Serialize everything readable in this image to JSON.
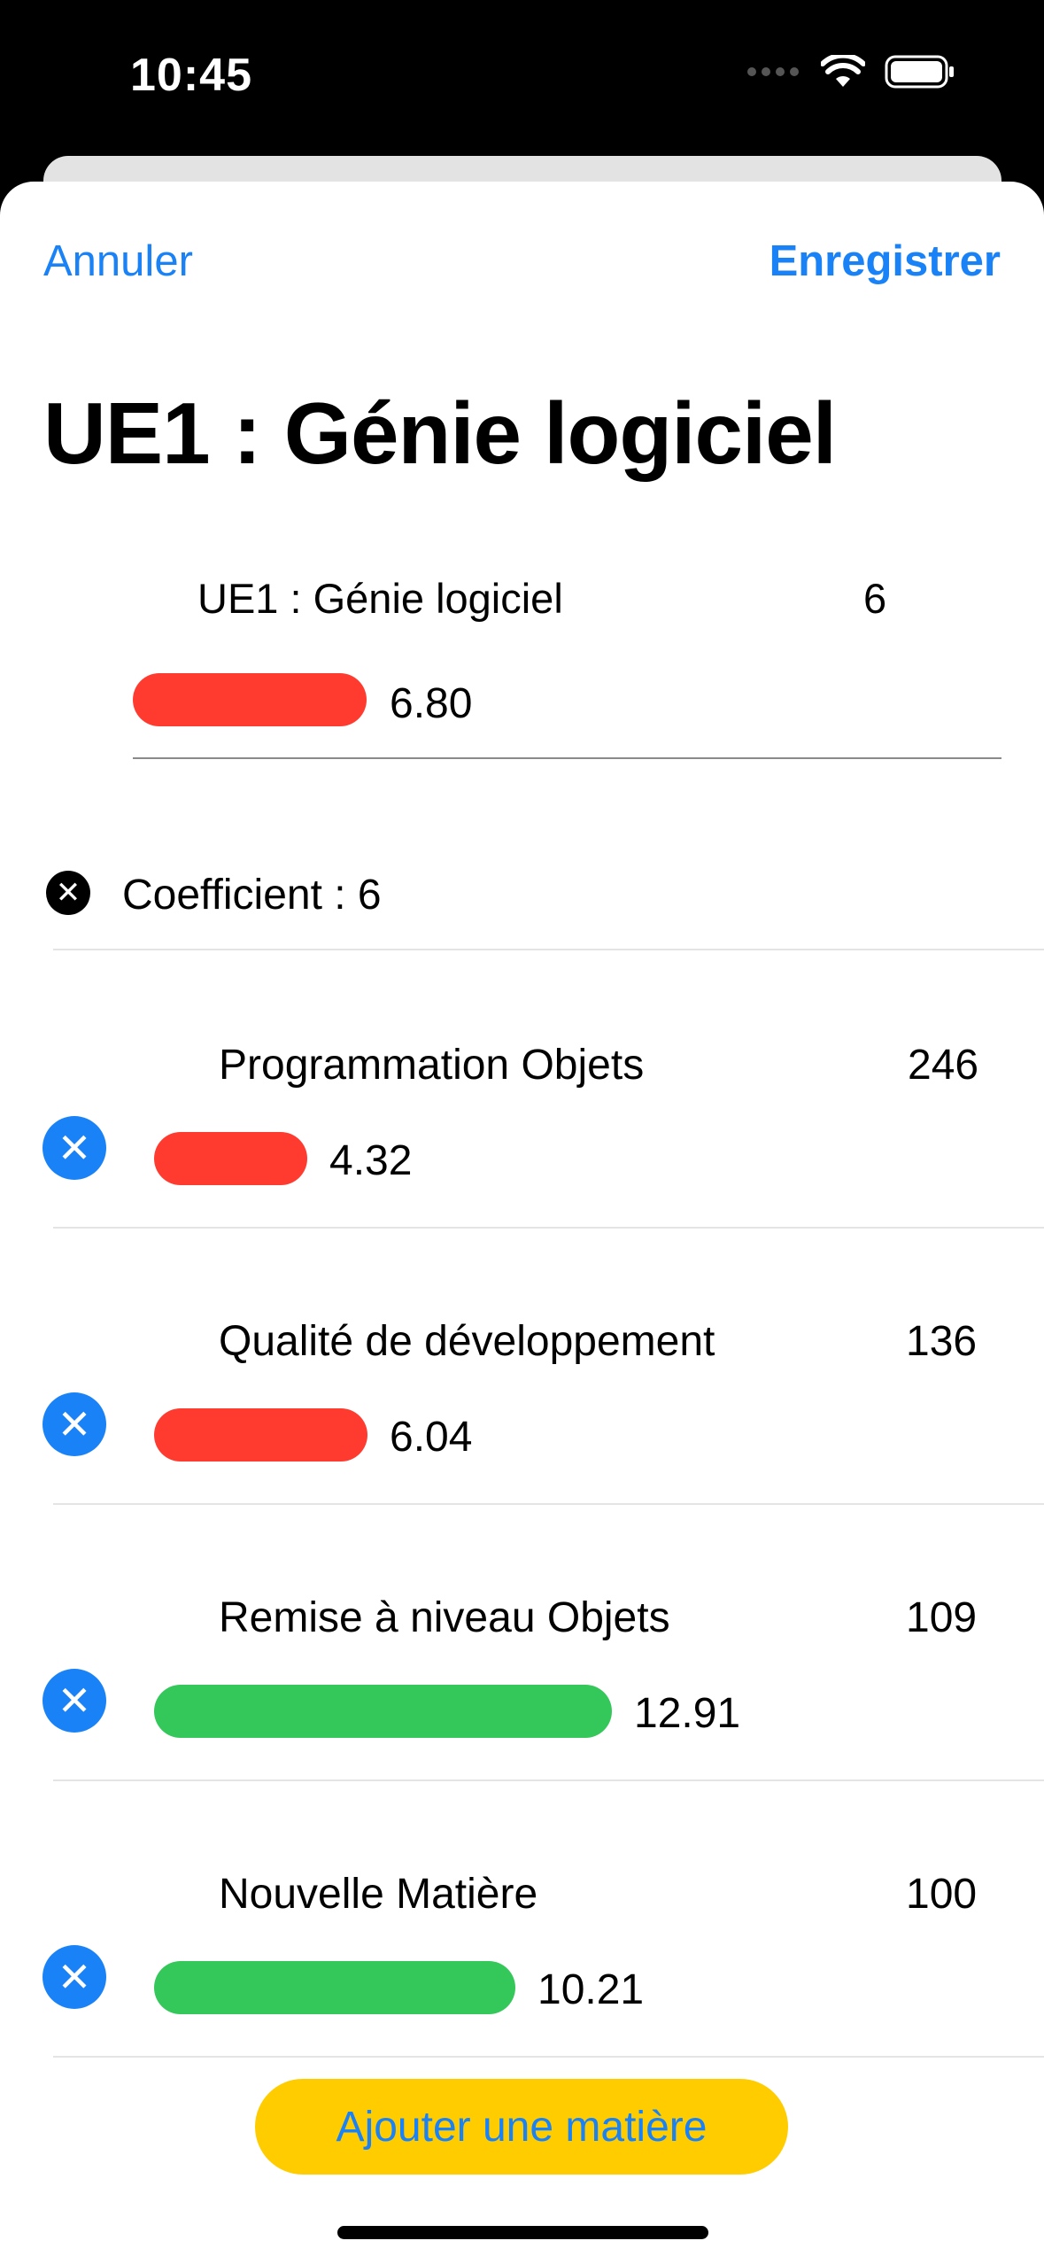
{
  "status": {
    "time": "10:45"
  },
  "nav": {
    "cancel": "Annuler",
    "save": "Enregistrer"
  },
  "title": "UE1 : Génie logiciel",
  "summary": {
    "name": "UE1 : Génie logiciel",
    "coefficient": "6",
    "average": "6.80",
    "average_fraction": 0.34,
    "status_color": "#ff3b30"
  },
  "coefficient_row": {
    "label": "Coefficient : 6"
  },
  "subjects": [
    {
      "name": "Programmation Objets",
      "hours": "246",
      "average": "4.32",
      "status": "red"
    },
    {
      "name": "Qualité de développement",
      "hours": "136",
      "average": "6.04",
      "status": "red"
    },
    {
      "name": "Remise à niveau Objets",
      "hours": "109",
      "average": "12.91",
      "status": "green"
    },
    {
      "name": "Nouvelle Matière",
      "hours": "100",
      "average": "10.21",
      "status": "green"
    }
  ],
  "add_button": "Ajouter une matière",
  "colors": {
    "accent": "#1a82f7",
    "fail": "#ff3b30",
    "pass": "#34c759",
    "add_button_bg": "#ffcc00"
  },
  "icons": {
    "remove_coefficient": "x-circle-black-icon",
    "remove_subject": "x-circle-blue-icon"
  }
}
